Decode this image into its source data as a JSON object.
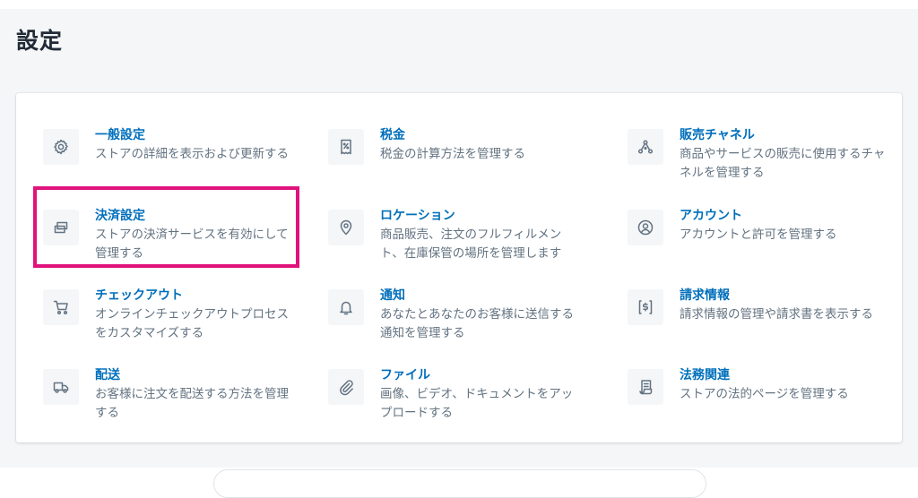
{
  "page": {
    "title": "設定"
  },
  "settings": [
    {
      "key": "general",
      "icon": "gear-icon",
      "title": "一般設定",
      "desc": "ストアの詳細を表示および更新する"
    },
    {
      "key": "taxes",
      "icon": "tax-receipt-icon",
      "title": "税金",
      "desc": "税金の計算方法を管理する"
    },
    {
      "key": "sales-channels",
      "icon": "channels-icon",
      "title": "販売チャネル",
      "desc": "商品やサービスの販売に使用するチャネルを管理する"
    },
    {
      "key": "payments",
      "icon": "payment-card-icon",
      "title": "決済設定",
      "desc": "ストアの決済サービスを有効にして管理する"
    },
    {
      "key": "locations",
      "icon": "location-pin-icon",
      "title": "ロケーション",
      "desc": "商品販売、注文のフルフィルメント、在庫保管の場所を管理します"
    },
    {
      "key": "account",
      "icon": "account-icon",
      "title": "アカウント",
      "desc": "アカウントと許可を管理する"
    },
    {
      "key": "checkout",
      "icon": "cart-icon",
      "title": "チェックアウト",
      "desc": "オンラインチェックアウトプロセスをカスタマイズする"
    },
    {
      "key": "notifications",
      "icon": "bell-icon",
      "title": "通知",
      "desc": "あなたとあなたのお客様に送信する通知を管理する"
    },
    {
      "key": "billing",
      "icon": "billing-icon",
      "title": "請求情報",
      "desc": "請求情報の管理や請求書を表示する"
    },
    {
      "key": "shipping",
      "icon": "truck-icon",
      "title": "配送",
      "desc": "お客様に注文を配送する方法を管理する"
    },
    {
      "key": "files",
      "icon": "paperclip-icon",
      "title": "ファイル",
      "desc": "画像、ビデオ、ドキュメントをアップロードする"
    },
    {
      "key": "legal",
      "icon": "legal-document-icon",
      "title": "法務関連",
      "desc": "ストアの法的ページを管理する"
    }
  ],
  "highlight": {
    "target": "payments",
    "color": "#e0127c"
  },
  "colors": {
    "link": "#006fbb",
    "text_subdued": "#637381",
    "heading": "#212b36",
    "background": "#f4f6f8"
  }
}
